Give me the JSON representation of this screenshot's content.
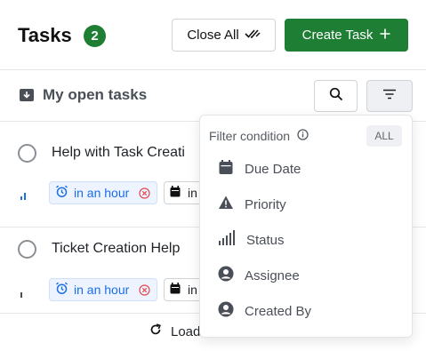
{
  "header": {
    "title": "Tasks",
    "count": "2",
    "close_all_label": "Close All",
    "create_task_label": "Create Task"
  },
  "subheader": {
    "title": "My open tasks"
  },
  "tasks": [
    {
      "title": "Help with Task Creati",
      "due": "in an hour",
      "date_label": "in"
    },
    {
      "title": "Ticket Creation Help",
      "due": "in an hour",
      "date_label": "in"
    }
  ],
  "load_more_label": "Load",
  "filter_menu": {
    "heading": "Filter condition",
    "all_label": "ALL",
    "items": [
      {
        "label": "Due Date",
        "icon": "calendar-icon"
      },
      {
        "label": "Priority",
        "icon": "warning-icon"
      },
      {
        "label": "Status",
        "icon": "signal-bars-icon"
      },
      {
        "label": "Assignee",
        "icon": "user-circle-icon"
      },
      {
        "label": "Created By",
        "icon": "user-circle-icon"
      }
    ]
  },
  "colors": {
    "brand_green": "#1e7e34",
    "chip_blue": "#1a6ee8",
    "chip_red": "#e5484d",
    "icon_gray": "#4a4f57"
  }
}
